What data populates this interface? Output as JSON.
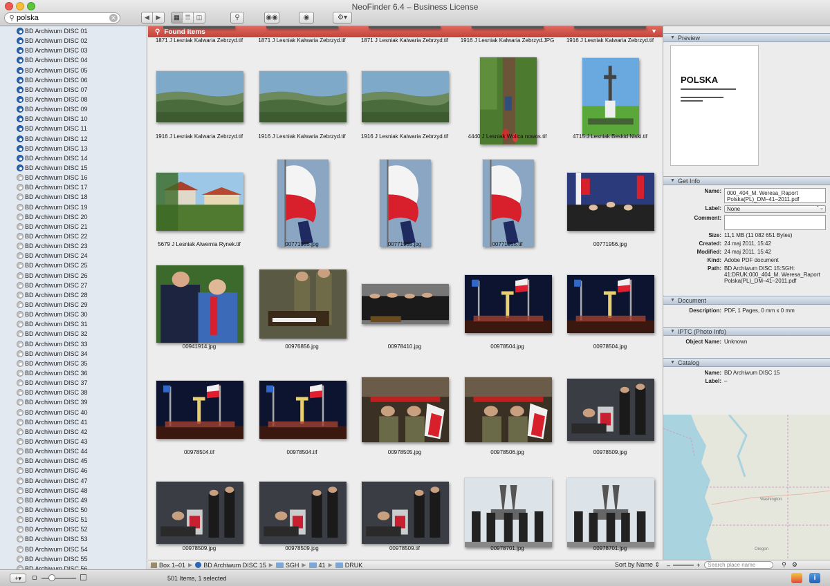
{
  "window": {
    "title": "NeoFinder 6.4 – Business License"
  },
  "search": {
    "value": "polska"
  },
  "sidebar": {
    "discs": [
      {
        "label": "BD Archiwum DISC 01",
        "online": true
      },
      {
        "label": "BD Archiwum DISC 02",
        "online": true
      },
      {
        "label": "BD Archiwum DISC 03",
        "online": true
      },
      {
        "label": "BD Archiwum DISC 04",
        "online": true
      },
      {
        "label": "BD Archiwum DISC 05",
        "online": true
      },
      {
        "label": "BD Archiwum DISC 06",
        "online": true
      },
      {
        "label": "BD Archiwum DISC 07",
        "online": true
      },
      {
        "label": "BD Archiwum DISC 08",
        "online": true
      },
      {
        "label": "BD Archiwum DISC 09",
        "online": true
      },
      {
        "label": "BD Archiwum DISC 10",
        "online": true
      },
      {
        "label": "BD Archiwum DISC 11",
        "online": true
      },
      {
        "label": "BD Archiwum DISC 12",
        "online": true
      },
      {
        "label": "BD Archiwum DISC 13",
        "online": true
      },
      {
        "label": "BD Archiwum DISC 14",
        "online": true
      },
      {
        "label": "BD Archiwum DISC 15",
        "online": true
      },
      {
        "label": "BD Archiwum DISC 16",
        "online": false
      },
      {
        "label": "BD Archiwum DISC 17",
        "online": false
      },
      {
        "label": "BD Archiwum DISC 18",
        "online": false
      },
      {
        "label": "BD Archiwum DISC 19",
        "online": false
      },
      {
        "label": "BD Archiwum DISC 20",
        "online": false
      },
      {
        "label": "BD Archiwum DISC 21",
        "online": false
      },
      {
        "label": "BD Archiwum DISC 22",
        "online": false
      },
      {
        "label": "BD Archiwum DISC 23",
        "online": false
      },
      {
        "label": "BD Archiwum DISC 24",
        "online": false
      },
      {
        "label": "BD Archiwum DISC 25",
        "online": false
      },
      {
        "label": "BD Archiwum DISC 26",
        "online": false
      },
      {
        "label": "BD Archiwum DISC 27",
        "online": false
      },
      {
        "label": "BD Archiwum DISC 28",
        "online": false
      },
      {
        "label": "BD Archiwum DISC 29",
        "online": false
      },
      {
        "label": "BD Archiwum DISC 30",
        "online": false
      },
      {
        "label": "BD Archiwum DISC 31",
        "online": false
      },
      {
        "label": "BD Archiwum DISC 32",
        "online": false
      },
      {
        "label": "BD Archiwum DISC 33",
        "online": false
      },
      {
        "label": "BD Archiwum DISC 34",
        "online": false
      },
      {
        "label": "BD Archiwum DISC 35",
        "online": false
      },
      {
        "label": "BD Archiwum DISC 36",
        "online": false
      },
      {
        "label": "BD Archiwum DISC 37",
        "online": false
      },
      {
        "label": "BD Archiwum DISC 38",
        "online": false
      },
      {
        "label": "BD Archiwum DISC 39",
        "online": false
      },
      {
        "label": "BD Archiwum DISC 40",
        "online": false
      },
      {
        "label": "BD Archiwum DISC 41",
        "online": false
      },
      {
        "label": "BD Archiwum DISC 42",
        "online": false
      },
      {
        "label": "BD Archiwum DISC 43",
        "online": false
      },
      {
        "label": "BD Archiwum DISC 44",
        "online": false
      },
      {
        "label": "BD Archiwum DISC 45",
        "online": false
      },
      {
        "label": "BD Archiwum DISC 46",
        "online": false
      },
      {
        "label": "BD Archiwum DISC 47",
        "online": false
      },
      {
        "label": "BD Archiwum DISC 48",
        "online": false
      },
      {
        "label": "BD Archiwum DISC 49",
        "online": false
      },
      {
        "label": "BD Archiwum DISC 50",
        "online": false
      },
      {
        "label": "BD Archiwum DISC 51",
        "online": false
      },
      {
        "label": "BD Archiwum DISC 52",
        "online": false
      },
      {
        "label": "BD Archiwum DISC 53",
        "online": false
      },
      {
        "label": "BD Archiwum DISC 54",
        "online": false
      },
      {
        "label": "BD Archiwum DISC 55",
        "online": false
      },
      {
        "label": "BD Archiwum DISC 56",
        "online": false
      }
    ]
  },
  "found": {
    "title": "Found Items"
  },
  "items": [
    {
      "caption": "1871 J Lesniak Kalwaria Zebrzyd.tif",
      "kind": "none"
    },
    {
      "caption": "1871 J Lesniak Kalwaria Zebrzyd.tif",
      "kind": "none"
    },
    {
      "caption": "1871 J Lesniak Kalwaria Zebrzyd.tif",
      "kind": "none"
    },
    {
      "caption": "1916 J Lesniak Kalwaria Zebrzyd.JPG",
      "kind": "none"
    },
    {
      "caption": "1916 J Lesniak Kalwaria Zebrzyd.tif",
      "kind": "none"
    },
    {
      "caption": "1916 J Lesniak Kalwaria Zebrzyd.tif",
      "kind": "landscape"
    },
    {
      "caption": "1916 J Lesniak Kalwaria Zebrzyd.tif",
      "kind": "landscape"
    },
    {
      "caption": "1916 J Lesniak Kalwaria Zebrzyd.tif",
      "kind": "landscape"
    },
    {
      "caption": "4440 J Lesniak  Wolica nowos.tif",
      "kind": "shrine"
    },
    {
      "caption": "4715 J Lesniak Beskid Niski.tif",
      "kind": "cross"
    },
    {
      "caption": "5679 J Lesniak Alwernia Rynek.tif",
      "kind": "village"
    },
    {
      "caption": "00771955.jpg",
      "kind": "flag"
    },
    {
      "caption": "00771955.jpg",
      "kind": "flag"
    },
    {
      "caption": "00771955.tif",
      "kind": "flag"
    },
    {
      "caption": "00771956.jpg",
      "kind": "ceremony"
    },
    {
      "caption": "00941914.jpg",
      "kind": "couple"
    },
    {
      "caption": "00976856.jpg",
      "kind": "signing"
    },
    {
      "caption": "00978410.jpg",
      "kind": "meeting"
    },
    {
      "caption": "00978504.jpg",
      "kind": "night"
    },
    {
      "caption": "00978504.jpg",
      "kind": "night"
    },
    {
      "caption": "00978504.tif",
      "kind": "night"
    },
    {
      "caption": "00978504.tif",
      "kind": "night"
    },
    {
      "caption": "00978505.jpg",
      "kind": "ceremony2"
    },
    {
      "caption": "00978506.jpg",
      "kind": "ceremony2"
    },
    {
      "caption": "00978509.jpg",
      "kind": "signing2"
    },
    {
      "caption": "00978509.jpg",
      "kind": "signing2"
    },
    {
      "caption": "00978509.jpg",
      "kind": "signing2"
    },
    {
      "caption": "00978509.tif",
      "kind": "signing2"
    },
    {
      "caption": "00978701.jpg",
      "kind": "monument"
    },
    {
      "caption": "00978701.jpg",
      "kind": "monument"
    }
  ],
  "pathbar": {
    "segments": [
      "Box 1–01",
      "BD Archiwum DISC 15",
      "SGH",
      "41",
      "DRUK"
    ],
    "sort": "Sort by Name"
  },
  "preview": {
    "head": "Preview",
    "doc_title": "POLSKA"
  },
  "getinfo": {
    "head": "Get Info",
    "name_label": "Name:",
    "name_value": "000_404_M. Weresa_Raport Polska(PL)_DM–41–2011.pdf",
    "label_label": "Label:",
    "label_value": "None",
    "comment_label": "Comment:",
    "size_label": "Size:",
    "size_value": "11,1 MB (11 082 651 Bytes)",
    "created_label": "Created:",
    "created_value": "24 maj 2011, 15:42",
    "modified_label": "Modified:",
    "modified_value": "24 maj 2011, 15:42",
    "kind_label": "Kind:",
    "kind_value": "Adobe PDF document",
    "path_label": "Path:",
    "path_value": "BD Archiwum DISC 15:SGH: 41:DRUK:000_404_M. Weresa_Raport Polska(PL)_DM–41–2011.pdf"
  },
  "document": {
    "head": "Document",
    "desc_label": "Description:",
    "desc_value": "PDF, 1 Pages, 0 mm x 0 mm"
  },
  "iptc": {
    "head": "IPTC (Photo Info)",
    "obj_label": "Object Name:",
    "obj_value": "Unknown"
  },
  "catalog": {
    "head": "Catalog",
    "name_label": "Name:",
    "name_value": "BD Archiwum DISC 15",
    "label_label": "Label:",
    "label_value": "–"
  },
  "map": {
    "search_placeholder": "Search place name",
    "label_washington": "Washington",
    "label_oregon": "Oregon"
  },
  "status": {
    "count": "501 Items, 1 selected"
  }
}
